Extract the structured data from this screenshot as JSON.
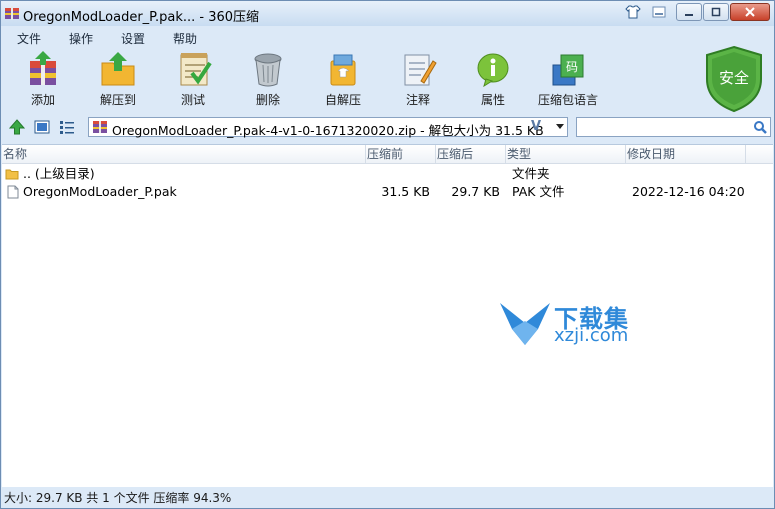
{
  "window": {
    "title": "OregonModLoader_P.pak... - 360压缩"
  },
  "menu": [
    "文件",
    "操作",
    "设置",
    "帮助"
  ],
  "toolbar": {
    "tools": [
      {
        "label": "添加",
        "icon": "add-archive-icon"
      },
      {
        "label": "解压到",
        "icon": "extract-folder-icon"
      },
      {
        "label": "测试",
        "icon": "test-checklist-icon"
      },
      {
        "label": "删除",
        "icon": "trash-bin-icon"
      },
      {
        "label": "自解压",
        "icon": "self-extract-icon"
      },
      {
        "label": "注释",
        "icon": "comment-notepad-icon"
      },
      {
        "label": "属性",
        "icon": "info-icon"
      },
      {
        "label": "压缩包语言",
        "icon": "archive-language-icon"
      }
    ],
    "security_badge": "安全"
  },
  "address": {
    "path": "OregonModLoader_P.pak-4-v1-0-1671320020.zip - 解包大小为 31.5 KB",
    "v_mark": "V",
    "search_placeholder": ""
  },
  "columns": [
    "名称",
    "压缩前",
    "压缩后",
    "类型",
    "修改日期"
  ],
  "rows": [
    {
      "name": ".. (上级目录)",
      "size": "",
      "packed": "",
      "type": "文件夹",
      "modified": ""
    },
    {
      "name": "OregonModLoader_P.pak",
      "size": "31.5 KB",
      "packed": "29.7 KB",
      "type": "PAK 文件",
      "modified": "2022-12-16 04:20"
    }
  ],
  "watermark": {
    "title": "下载集",
    "domain": "xzji.com"
  },
  "status": {
    "text": "大小: 29.7 KB 共 1 个文件 压缩率 94.3%"
  },
  "colors": {
    "accent": "#2f89d9",
    "shield_green": "#4aa23a",
    "chrome": "#dce9f7"
  }
}
